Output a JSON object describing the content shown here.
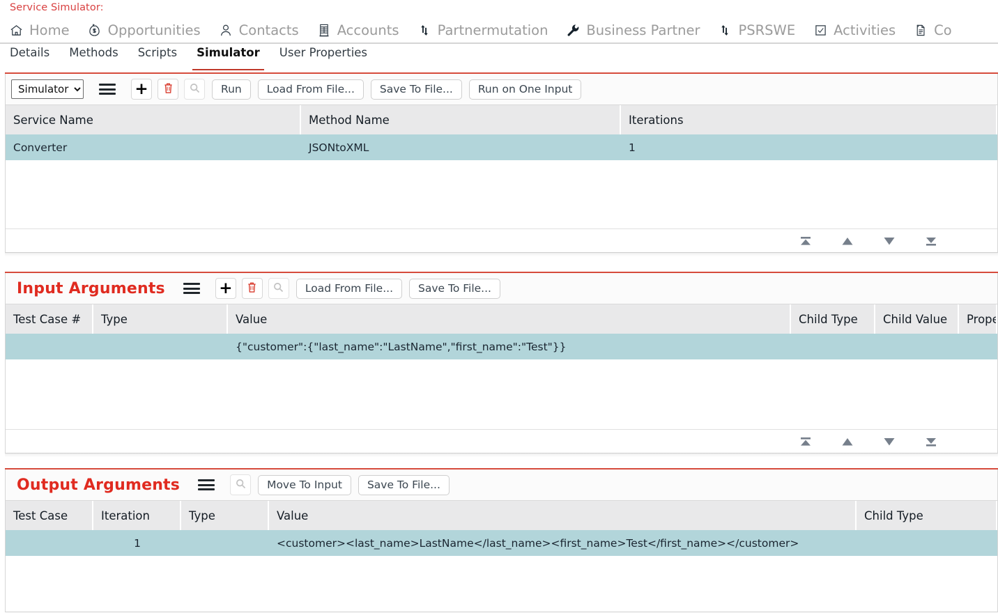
{
  "header": {
    "screen_title": "Service Simulator:",
    "nav_tabs": [
      {
        "label": "Home",
        "icon": "home-icon"
      },
      {
        "label": "Opportunities",
        "icon": "money-bag-icon"
      },
      {
        "label": "Contacts",
        "icon": "person-icon"
      },
      {
        "label": "Accounts",
        "icon": "building-icon"
      },
      {
        "label": "Partnermutation",
        "icon": "swap-arrows-icon"
      },
      {
        "label": "Business Partner",
        "icon": "wrench-icon"
      },
      {
        "label": "PSRSWE",
        "icon": "swap-arrows-icon"
      },
      {
        "label": "Activities",
        "icon": "checkbox-icon"
      },
      {
        "label": "Co",
        "icon": "document-icon"
      }
    ],
    "sub_tabs": [
      {
        "label": "Details",
        "active": false
      },
      {
        "label": "Methods",
        "active": false
      },
      {
        "label": "Scripts",
        "active": false
      },
      {
        "label": "Simulator",
        "active": true
      },
      {
        "label": "User Properties",
        "active": false
      }
    ]
  },
  "simulator_panel": {
    "toolbar": {
      "view_select_value": "Simulator",
      "view_select_options": [
        "Simulator"
      ],
      "menu_icon": "hamburger-menu-icon",
      "add_icon": "plus-icon",
      "delete_icon": "trash-icon",
      "search_icon": "search-icon",
      "run_label": "Run",
      "load_from_file_label": "Load From File...",
      "save_to_file_label": "Save To File...",
      "run_on_one_input_label": "Run on One Input"
    },
    "columns": [
      "Service Name",
      "Method Name",
      "Iterations"
    ],
    "rows": [
      {
        "service_name": "Converter",
        "method_name": "JSONtoXML",
        "iterations": "1",
        "selected": true
      }
    ]
  },
  "input_arguments_panel": {
    "heading": "Input Arguments",
    "toolbar": {
      "menu_icon": "hamburger-menu-icon",
      "add_icon": "plus-icon",
      "delete_icon": "trash-icon",
      "search_icon": "search-icon",
      "load_from_file_label": "Load From File...",
      "save_to_file_label": "Save To File..."
    },
    "columns": [
      "Test Case #",
      "Type",
      "Value",
      "Child Type",
      "Child Value",
      "Prope"
    ],
    "rows": [
      {
        "test_case": "",
        "type": "",
        "value": "{\"customer\":{\"last_name\":\"LastName\",\"first_name\":\"Test\"}}",
        "child_type": "",
        "child_value": "",
        "property": "",
        "selected": true
      }
    ]
  },
  "output_arguments_panel": {
    "heading": "Output Arguments",
    "toolbar": {
      "menu_icon": "hamburger-menu-icon",
      "search_icon": "search-icon",
      "move_to_input_label": "Move To Input",
      "save_to_file_label": "Save To File..."
    },
    "columns": [
      "Test Case",
      "Iteration",
      "Type",
      "Value",
      "Child Type"
    ],
    "rows": [
      {
        "test_case": "",
        "iteration": "1",
        "type": "",
        "value": "<customer><last_name>LastName</last_name><first_name>Test</first_name></customer>",
        "child_type": "",
        "selected": true
      }
    ]
  },
  "pager": {
    "first_icon": "go-to-first-icon",
    "previous_icon": "go-to-previous-icon",
    "next_icon": "go-to-next-icon",
    "last_icon": "go-to-last-icon"
  },
  "colors": {
    "accent_red": "#e02b20",
    "rule_red": "#d64b3c",
    "selected_row": "#b2d5da",
    "header_cell": "#e9e9ea",
    "nav_text": "#9b9b9b"
  }
}
